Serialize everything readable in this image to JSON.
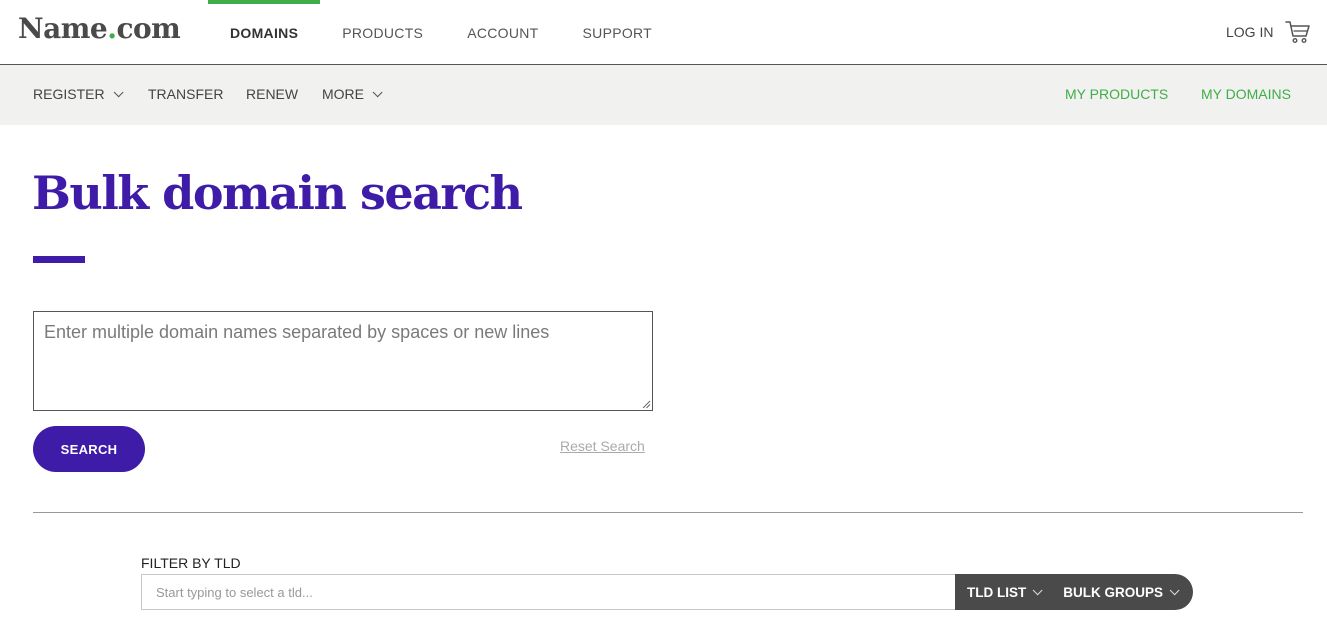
{
  "header": {
    "logo": {
      "name": "Name",
      "dot": ".",
      "tld": "com"
    },
    "nav": [
      {
        "label": "DOMAINS",
        "active": true
      },
      {
        "label": "PRODUCTS",
        "active": false
      },
      {
        "label": "ACCOUNT",
        "active": false
      },
      {
        "label": "SUPPORT",
        "active": false
      }
    ],
    "login_label": "LOG IN",
    "cart_icon": "cart-icon"
  },
  "subnav": {
    "register": "REGISTER",
    "transfer": "TRANSFER",
    "renew": "RENEW",
    "more": "MORE",
    "my_products": "MY PRODUCTS",
    "my_domains": "MY DOMAINS"
  },
  "main": {
    "title": "Bulk domain search",
    "domain_input": {
      "value": "",
      "placeholder": "Enter multiple domain names separated by spaces or new lines"
    },
    "search_label": "SEARCH",
    "reset_label": "Reset Search"
  },
  "filter": {
    "label": "FILTER BY TLD",
    "placeholder": "Start typing to select a tld...",
    "tld_list_label": "TLD LIST",
    "bulk_groups_label": "BULK GROUPS"
  },
  "colors": {
    "accent_purple": "#3e1ca8",
    "accent_green": "#3fae49",
    "subnav_bg": "#f1f1ef",
    "tld_buttons_bg": "#4a4a4a"
  }
}
